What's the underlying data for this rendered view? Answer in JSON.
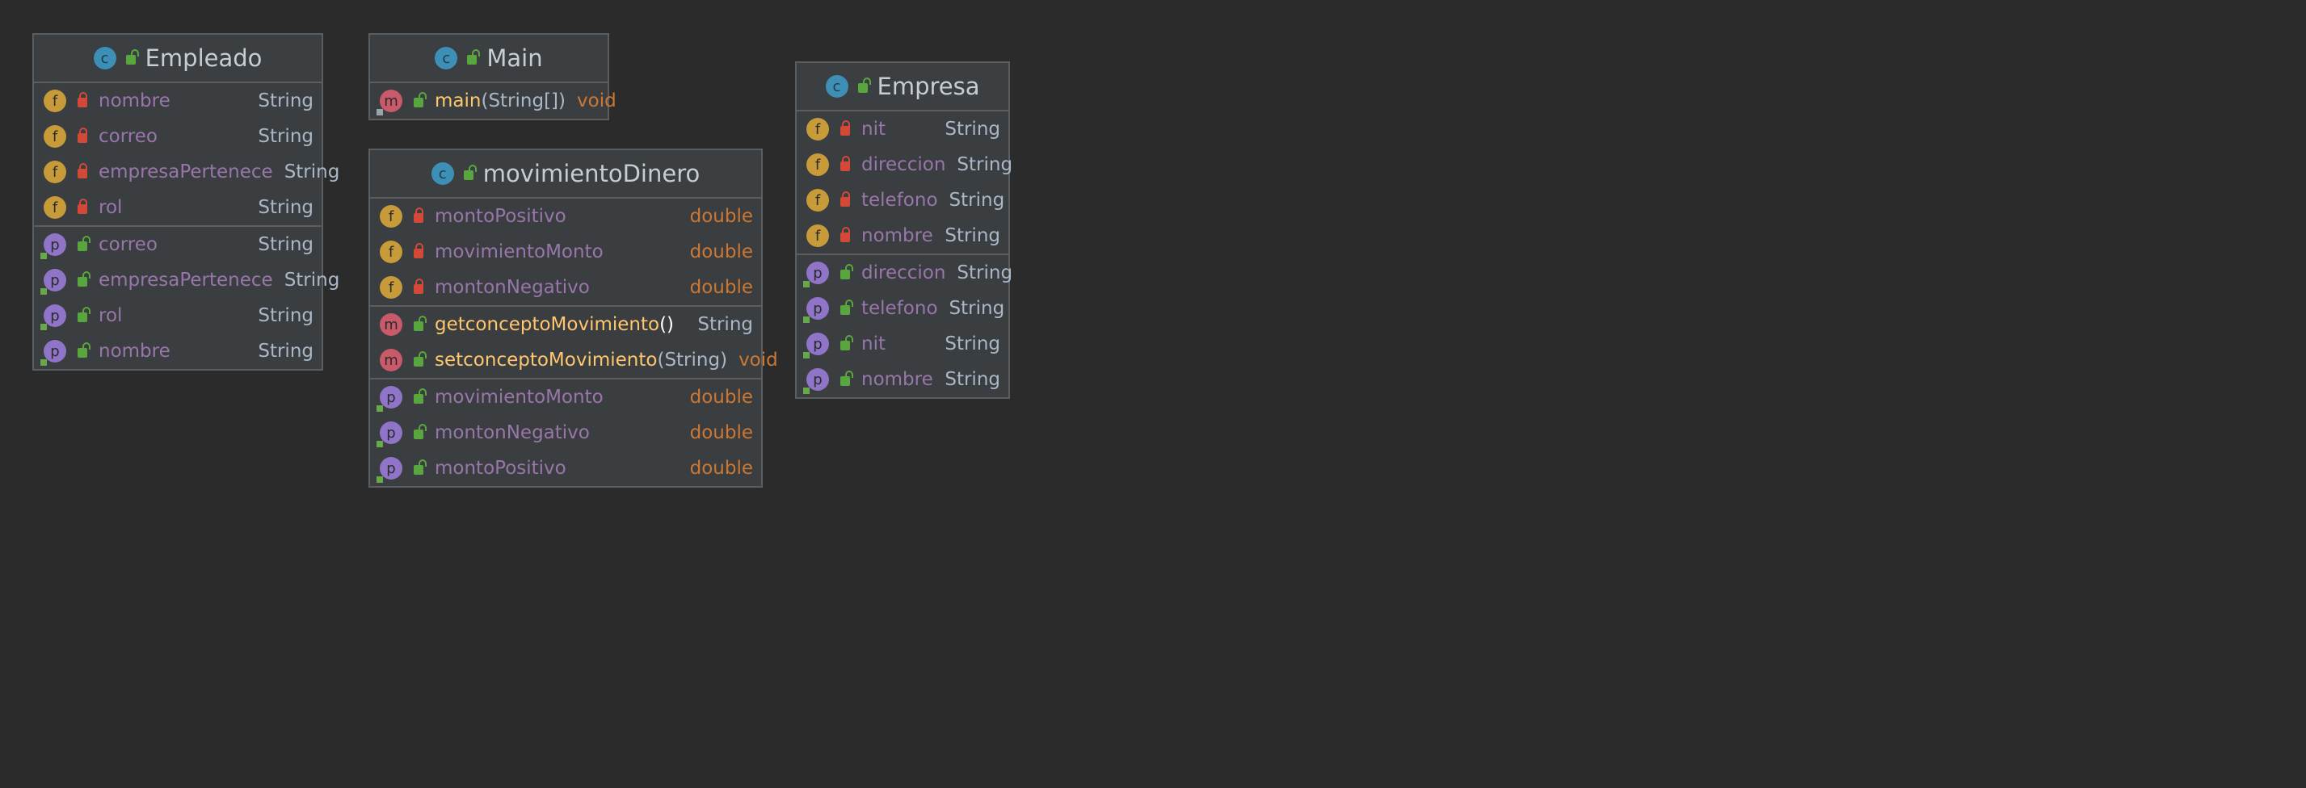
{
  "classes": {
    "empleado": {
      "name": "Empleado",
      "fields": [
        {
          "name": "nombre",
          "type": "String"
        },
        {
          "name": "correo",
          "type": "String"
        },
        {
          "name": "empresaPertenece",
          "type": "String"
        },
        {
          "name": "rol",
          "type": "String"
        }
      ],
      "properties": [
        {
          "name": "correo",
          "type": "String"
        },
        {
          "name": "empresaPertenece",
          "type": "String"
        },
        {
          "name": "rol",
          "type": "String"
        },
        {
          "name": "nombre",
          "type": "String"
        }
      ]
    },
    "main": {
      "name": "Main",
      "methods": [
        {
          "name": "main",
          "params": "(String[])",
          "type": "void"
        }
      ]
    },
    "movimiento": {
      "name": "movimientoDinero",
      "fields": [
        {
          "name": "montoPositivo",
          "type": "double"
        },
        {
          "name": "movimientoMonto",
          "type": "double"
        },
        {
          "name": "montonNegativo",
          "type": "double"
        }
      ],
      "methods": [
        {
          "name": "getconceptoMovimiento",
          "params": "()",
          "type": "String"
        },
        {
          "name": "setconceptoMovimiento",
          "params": "(String)",
          "type": "void"
        }
      ],
      "properties": [
        {
          "name": "movimientoMonto",
          "type": "double"
        },
        {
          "name": "montonNegativo",
          "type": "double"
        },
        {
          "name": "montoPositivo",
          "type": "double"
        }
      ]
    },
    "empresa": {
      "name": "Empresa",
      "fields": [
        {
          "name": "nit",
          "type": "String"
        },
        {
          "name": "direccion",
          "type": "String"
        },
        {
          "name": "telefono",
          "type": "String"
        },
        {
          "name": "nombre",
          "type": "String"
        }
      ],
      "properties": [
        {
          "name": "direccion",
          "type": "String"
        },
        {
          "name": "telefono",
          "type": "String"
        },
        {
          "name": "nit",
          "type": "String"
        },
        {
          "name": "nombre",
          "type": "String"
        }
      ]
    }
  },
  "badges": {
    "class": "c",
    "field": "f",
    "method": "m",
    "property": "p"
  },
  "colors": {
    "background": "#2b2b2b",
    "box": "#3b3e40",
    "field_name": "#9876aa",
    "method_name": "#ffc66d",
    "primitive_type": "#cc7832",
    "object_type": "#a9b7c6"
  }
}
